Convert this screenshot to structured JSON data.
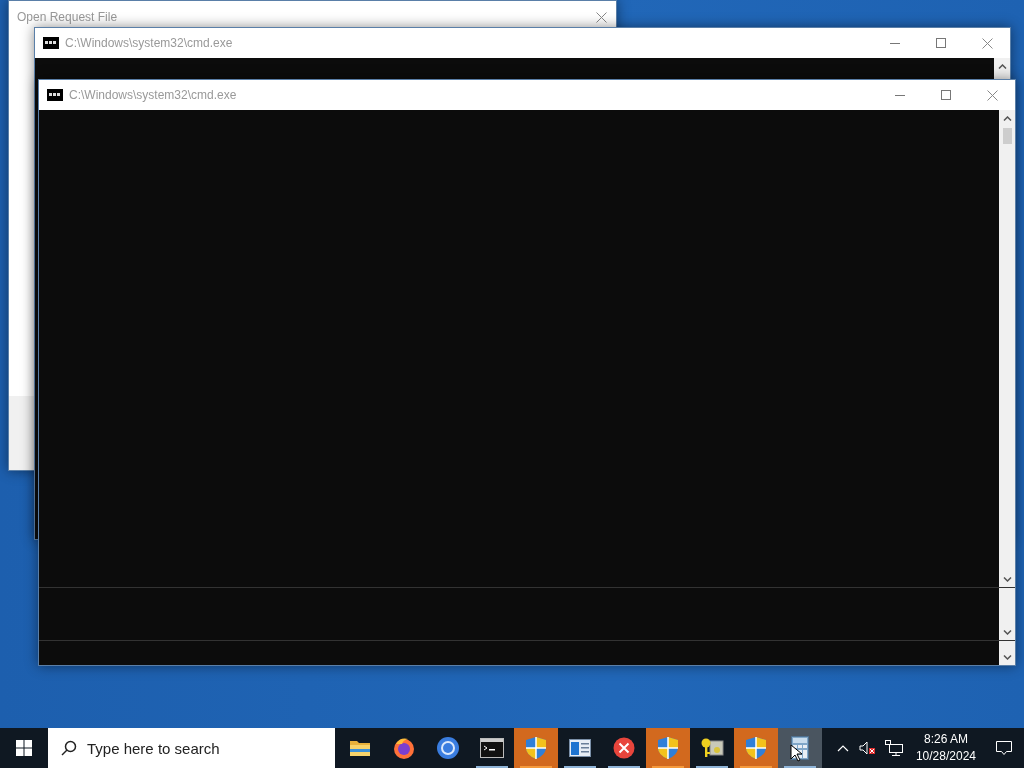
{
  "windows": [
    {
      "kind": "dialog",
      "title": "Open Request File"
    },
    {
      "kind": "console",
      "title": "C:\\Windows\\system32\\cmd.exe"
    },
    {
      "kind": "split-console",
      "title": "C:\\Windows\\system32\\cmd.exe"
    }
  ],
  "taskbar": {
    "search": {
      "placeholder": "Type here to search"
    },
    "apps": [
      {
        "kind": "folder",
        "running": false,
        "flashing": false,
        "hovered": false
      },
      {
        "kind": "firefox",
        "running": false,
        "flashing": false,
        "hovered": false
      },
      {
        "kind": "browser",
        "running": false,
        "flashing": false,
        "hovered": false
      },
      {
        "kind": "console",
        "running": true,
        "flashing": false,
        "hovered": false
      },
      {
        "kind": "shield",
        "running": true,
        "flashing": true,
        "hovered": false
      },
      {
        "kind": "window",
        "running": true,
        "flashing": false,
        "hovered": false
      },
      {
        "kind": "error",
        "running": true,
        "flashing": false,
        "hovered": false
      },
      {
        "kind": "shield",
        "running": true,
        "flashing": true,
        "hovered": false
      },
      {
        "kind": "keys",
        "running": true,
        "flashing": false,
        "hovered": false
      },
      {
        "kind": "shield",
        "running": true,
        "flashing": true,
        "hovered": false
      },
      {
        "kind": "calculator",
        "running": true,
        "flashing": false,
        "hovered": true
      }
    ],
    "clock": {
      "time": "8:26 AM",
      "date": "10/28/2024"
    }
  }
}
